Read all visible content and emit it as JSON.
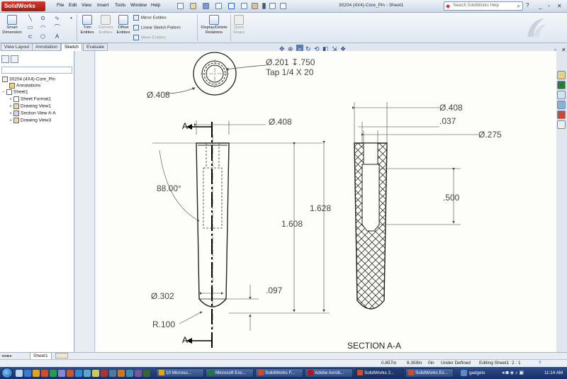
{
  "app": {
    "brand": "SolidWorks",
    "menu": [
      "File",
      "Edit",
      "View",
      "Insert",
      "Tools",
      "Window",
      "Help"
    ],
    "document_title": "30204 (4X4)-Core_Pin - Sheet1",
    "search_placeholder": "Search SolidWorks Help"
  },
  "ribbon": {
    "smart_dimension": "Smart Dimension",
    "trim_entities": "Trim Entities",
    "convert_entities": "Convert Entities",
    "offset_entities": "Offset Entities",
    "mirror_entities": "Mirror Entities",
    "linear_sketch_pattern": "Linear Sketch Pattern",
    "move_entities": "Move Entities",
    "display_delete_relations": "Display/Delete Relations",
    "quick_snaps": "Quick Snaps"
  },
  "command_tabs": [
    "View Layout",
    "Annotation",
    "Sketch",
    "Evaluate"
  ],
  "active_tab": "Sketch",
  "feature_tree": {
    "root": "30204 (4X4)-Core_Pin",
    "items": [
      {
        "label": "Annotations",
        "level": 1
      },
      {
        "label": "Sheet1",
        "level": 1
      },
      {
        "label": "Sheet Format1",
        "level": 2
      },
      {
        "label": "Drawing View1",
        "level": 2
      },
      {
        "label": "Section View A-A",
        "level": 2
      },
      {
        "label": "Drawing View3",
        "level": 2
      }
    ]
  },
  "drawing": {
    "top_dia": "Ø.408",
    "hole_note_1": "Ø.201 ↧.750",
    "hole_note_2": "Tap 1/4 X 20",
    "front_dia": "Ø.408",
    "angle": "88.00°",
    "len_1628": "1.628",
    "len_1608": "1.608",
    "tip_dia": "Ø.302",
    "dim_097": ".097",
    "radius": "R.100",
    "section_letter_top": "A",
    "section_letter_bottom": "A",
    "sec_dia_408": "Ø.408",
    "sec_037": ".037",
    "sec_dia_275": "Ø.275",
    "sec_500": ".500",
    "section_label": "SECTION A-A"
  },
  "sheet_tab": "Sheet1",
  "status": {
    "x": "0.857in",
    "y": "6.359in",
    "z": "0in",
    "state": "Under Defined",
    "editing": "Editing Sheet1",
    "scale": "2 : 1"
  },
  "taskbar": {
    "buttons": [
      {
        "label": "10 Microso...",
        "color": "#e3a21a"
      },
      {
        "label": "Microsoft Exc...",
        "color": "#1f7a3a"
      },
      {
        "label": "SolidWorks F...",
        "color": "#d24b2a"
      },
      {
        "label": "Adobe Acrob...",
        "color": "#b3161b"
      },
      {
        "label": "SolidWorks 2...",
        "color": "#d24b2a"
      },
      {
        "label": "SolidWorks Ex...",
        "color": "#d24b2a"
      }
    ],
    "gadgets": "gadgets",
    "time": "11:14 AM"
  }
}
